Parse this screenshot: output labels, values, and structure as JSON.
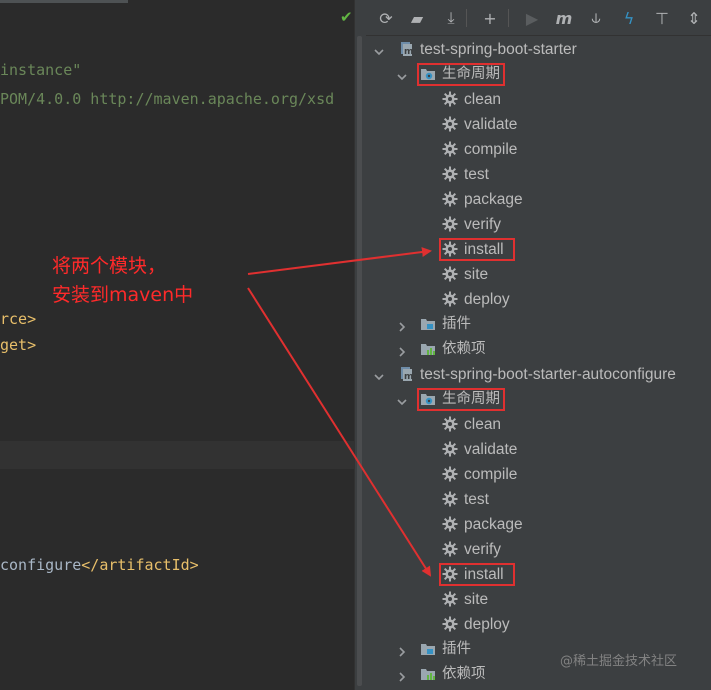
{
  "editor": {
    "lines": [
      {
        "parts": [
          {
            "cls": "str",
            "text": "instance\""
          }
        ]
      },
      {
        "parts": [
          {
            "cls": "str",
            "text": "POM/4.0.0 http://maven.apache.org/xsd"
          }
        ]
      },
      {
        "parts": [
          {
            "cls": "tag",
            "text": "rce>"
          }
        ]
      },
      {
        "parts": [
          {
            "cls": "tag",
            "text": "get>"
          }
        ]
      },
      {
        "parts": [
          {
            "cls": "txt",
            "text": "configure"
          },
          {
            "cls": "tag",
            "text": "</artifactId>"
          }
        ]
      }
    ]
  },
  "maven": {
    "toolbar": [
      {
        "name": "reload-icon",
        "glyph": "⟳"
      },
      {
        "name": "add-folder-icon",
        "glyph": "▰"
      },
      {
        "name": "download-icon",
        "glyph": "⤓"
      },
      {
        "name": "add-icon",
        "glyph": "+"
      },
      {
        "name": "run-icon",
        "glyph": "▶"
      },
      {
        "name": "maven-execute-icon",
        "glyph": "m"
      },
      {
        "name": "toggle-offline-icon",
        "glyph": "⫝"
      },
      {
        "name": "skip-tests-icon",
        "glyph": "ϟ"
      },
      {
        "name": "show-dependencies-icon",
        "glyph": "⊤"
      },
      {
        "name": "collapse-all-icon",
        "glyph": "⇕"
      }
    ],
    "projects": [
      {
        "name": "test-spring-boot-starter",
        "lifecycle_label": "生命周期",
        "goals": [
          "clean",
          "validate",
          "compile",
          "test",
          "package",
          "verify",
          "install",
          "site",
          "deploy"
        ],
        "plugins_label": "插件",
        "dependencies_label": "依赖项"
      },
      {
        "name": "test-spring-boot-starter-autoconfigure",
        "lifecycle_label": "生命周期",
        "goals": [
          "clean",
          "validate",
          "compile",
          "test",
          "package",
          "verify",
          "install",
          "site",
          "deploy"
        ],
        "plugins_label": "插件",
        "dependencies_label": "依赖项"
      }
    ]
  },
  "annotation": {
    "line1": "将两个模块，",
    "line2": "安装到maven中"
  },
  "watermark": "@稀土掘金技术社区",
  "colors": {
    "annotation_red": "#e03030",
    "tree_text": "#bbbbbb",
    "panel_bg": "#3c3f41",
    "editor_bg": "#2b2b2b",
    "check_green": "#62b543"
  }
}
